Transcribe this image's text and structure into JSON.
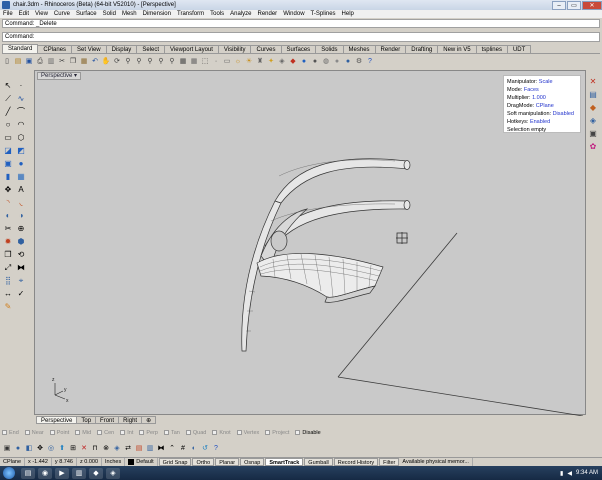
{
  "window": {
    "title": "chair.3dm - Rhinoceros (Beta) (64-bit V52010) - [Perspective]",
    "minimize": "–",
    "maximize": "▭",
    "close": "✕"
  },
  "menu": [
    "File",
    "Edit",
    "View",
    "Curve",
    "Surface",
    "Solid",
    "Mesh",
    "Dimension",
    "Transform",
    "Tools",
    "Analyze",
    "Render",
    "Window",
    "T-Splines",
    "Help"
  ],
  "command": {
    "history": "Command: _Delete",
    "prompt_label": "Command:",
    "value": ""
  },
  "tabs": [
    "Standard",
    "CPlanes",
    "Set View",
    "Display",
    "Select",
    "Viewport Layout",
    "Visibility",
    "Curves",
    "Surfaces",
    "Solids",
    "Meshes",
    "Render",
    "Drafting",
    "New in V5",
    "tsplines",
    "UDT"
  ],
  "active_tab": "Standard",
  "toolbar_icons": [
    {
      "name": "new-icon",
      "glyph": "▯",
      "color": "#444"
    },
    {
      "name": "open-icon",
      "glyph": "▤",
      "color": "#b08020"
    },
    {
      "name": "save-icon",
      "glyph": "▣",
      "color": "#2050a0"
    },
    {
      "name": "print-icon",
      "glyph": "⎙",
      "color": "#444"
    },
    {
      "name": "import-icon",
      "glyph": "▥",
      "color": "#666"
    },
    {
      "name": "cut-icon",
      "glyph": "✂",
      "color": "#444"
    },
    {
      "name": "copy-icon",
      "glyph": "❐",
      "color": "#444"
    },
    {
      "name": "paste-icon",
      "glyph": "▦",
      "color": "#8a6a30"
    },
    {
      "name": "undo-icon",
      "glyph": "↶",
      "color": "#2050a0"
    },
    {
      "name": "pan-icon",
      "glyph": "✋",
      "color": "#444"
    },
    {
      "name": "rotate-view-icon",
      "glyph": "⟳",
      "color": "#444"
    },
    {
      "name": "zoom-icon",
      "glyph": "⚲",
      "color": "#444"
    },
    {
      "name": "zoom-window-icon",
      "glyph": "⚲",
      "color": "#444"
    },
    {
      "name": "zoom-extents-icon",
      "glyph": "⚲",
      "color": "#444"
    },
    {
      "name": "zoom-selected-icon",
      "glyph": "⚲",
      "color": "#444"
    },
    {
      "name": "zoom-all-icon",
      "glyph": "⚲",
      "color": "#444"
    },
    {
      "name": "four-view-icon",
      "glyph": "▦",
      "color": "#444"
    },
    {
      "name": "grid-icon",
      "glyph": "▦",
      "color": "#666"
    },
    {
      "name": "cplane-icon",
      "glyph": "⬚",
      "color": "#444"
    },
    {
      "name": "point-icon",
      "glyph": "·",
      "color": "#444"
    },
    {
      "name": "select-icon",
      "glyph": "▭",
      "color": "#666"
    },
    {
      "name": "show-icon",
      "glyph": "☼",
      "color": "#c89020"
    },
    {
      "name": "hide-icon",
      "glyph": "☀",
      "color": "#c89020"
    },
    {
      "name": "lock-icon",
      "glyph": "♜",
      "color": "#666"
    },
    {
      "name": "lightbulb-icon",
      "glyph": "✦",
      "color": "#d0a020"
    },
    {
      "name": "properties-icon",
      "glyph": "◈",
      "color": "#666"
    },
    {
      "name": "layers-icon",
      "glyph": "◆",
      "color": "#c03020"
    },
    {
      "name": "render-icon",
      "glyph": "●",
      "color": "#2060c0"
    },
    {
      "name": "shade-icon",
      "glyph": "●",
      "color": "#555"
    },
    {
      "name": "wire-sphere-icon",
      "glyph": "◍",
      "color": "#666"
    },
    {
      "name": "rendered-sphere-icon",
      "glyph": "●",
      "color": "#8a8a8a"
    },
    {
      "name": "material-sphere-icon",
      "glyph": "●",
      "color": "#3060a0"
    },
    {
      "name": "options-icon",
      "glyph": "⚙",
      "color": "#555"
    },
    {
      "name": "help-icon",
      "glyph": "?",
      "color": "#2050c0"
    }
  ],
  "left_tools": [
    {
      "name": "select-arrow-icon",
      "glyph": "↖",
      "color": "#000"
    },
    {
      "name": "point-tool-icon",
      "glyph": "·",
      "color": "#000"
    },
    {
      "name": "polyline-icon",
      "glyph": "⟋",
      "color": "#000"
    },
    {
      "name": "curve-cv-icon",
      "glyph": "∿",
      "color": "#2050a0"
    },
    {
      "name": "line-icon",
      "glyph": "╱",
      "color": "#000"
    },
    {
      "name": "curve-icon",
      "glyph": "⌒",
      "color": "#000"
    },
    {
      "name": "circle-icon",
      "glyph": "○",
      "color": "#000"
    },
    {
      "name": "arc-icon",
      "glyph": "◠",
      "color": "#000"
    },
    {
      "name": "rectangle-icon",
      "glyph": "▭",
      "color": "#000"
    },
    {
      "name": "polygon-icon",
      "glyph": "⬡",
      "color": "#000"
    },
    {
      "name": "surface-icon",
      "glyph": "◪",
      "color": "#2060c0"
    },
    {
      "name": "extrude-icon",
      "glyph": "◩",
      "color": "#2060c0"
    },
    {
      "name": "box-icon",
      "glyph": "▣",
      "color": "#2060c0"
    },
    {
      "name": "sphere-icon",
      "glyph": "●",
      "color": "#2060c0"
    },
    {
      "name": "cylinder-icon",
      "glyph": "▮",
      "color": "#2060c0"
    },
    {
      "name": "mesh-icon",
      "glyph": "▦",
      "color": "#3070c0"
    },
    {
      "name": "move-icon",
      "glyph": "✥",
      "color": "#000"
    },
    {
      "name": "text-icon",
      "glyph": "A",
      "color": "#000"
    },
    {
      "name": "fillet-icon",
      "glyph": "◝",
      "color": "#c05020"
    },
    {
      "name": "blend-icon",
      "glyph": "◟",
      "color": "#c05020"
    },
    {
      "name": "boolean-icon",
      "glyph": "◐",
      "color": "#3060a0"
    },
    {
      "name": "split-icon",
      "glyph": "◑",
      "color": "#3060a0"
    },
    {
      "name": "trim-icon",
      "glyph": "✂",
      "color": "#000"
    },
    {
      "name": "join-icon",
      "glyph": "⊕",
      "color": "#000"
    },
    {
      "name": "explode-icon",
      "glyph": "✹",
      "color": "#c04020"
    },
    {
      "name": "group-icon",
      "glyph": "⬢",
      "color": "#3060a0"
    },
    {
      "name": "copy-tool-icon",
      "glyph": "❐",
      "color": "#000"
    },
    {
      "name": "rotate-icon",
      "glyph": "⟲",
      "color": "#000"
    },
    {
      "name": "scale-icon",
      "glyph": "⤢",
      "color": "#000"
    },
    {
      "name": "mirror-icon",
      "glyph": "⧓",
      "color": "#000"
    },
    {
      "name": "array-icon",
      "glyph": "⣿",
      "color": "#3060a0"
    },
    {
      "name": "analyze-icon",
      "glyph": "⌖",
      "color": "#3060a0"
    },
    {
      "name": "dimension-icon",
      "glyph": "↔",
      "color": "#000"
    },
    {
      "name": "check-icon",
      "glyph": "✓",
      "color": "#000"
    },
    {
      "name": "paint-icon",
      "glyph": "✎",
      "color": "#d08020"
    }
  ],
  "right_tools": [
    {
      "name": "close-panel-icon",
      "glyph": "✕",
      "color": "#c03020"
    },
    {
      "name": "properties-panel-icon",
      "glyph": "▤",
      "color": "#3060a0"
    },
    {
      "name": "layers-panel-icon",
      "glyph": "◆",
      "color": "#c06020"
    },
    {
      "name": "display-panel-icon",
      "glyph": "◈",
      "color": "#3060a0"
    },
    {
      "name": "help-panel-icon",
      "glyph": "▣",
      "color": "#444"
    },
    {
      "name": "tspline-panel-icon",
      "glyph": "✿",
      "color": "#c02080"
    }
  ],
  "viewport": {
    "label": "Perspective",
    "info": [
      {
        "key": "Manipulator: ",
        "value": "Scale"
      },
      {
        "key": "Mode: ",
        "value": "Faces"
      },
      {
        "key": "Multiplier: ",
        "value": "1.000"
      },
      {
        "key": "DragMode: ",
        "value": "CPlane"
      },
      {
        "key": "Soft manipulation: ",
        "value": "Disabled"
      },
      {
        "key": "Hotkeys: ",
        "value": "Enabled"
      },
      {
        "key": "Selection empty",
        "value": ""
      }
    ],
    "axis_x": "x",
    "axis_y": "y",
    "axis_z": "z"
  },
  "view_tabs": [
    "Perspective",
    "Top",
    "Front",
    "Right"
  ],
  "view_tab_add": "⊕",
  "osnaps": [
    {
      "label": "End",
      "enabled": false
    },
    {
      "label": "Near",
      "enabled": false
    },
    {
      "label": "Point",
      "enabled": false
    },
    {
      "label": "Mid",
      "enabled": false
    },
    {
      "label": "Cen",
      "enabled": false
    },
    {
      "label": "Int",
      "enabled": false
    },
    {
      "label": "Perp",
      "enabled": false
    },
    {
      "label": "Tan",
      "enabled": false
    },
    {
      "label": "Quad",
      "enabled": false
    },
    {
      "label": "Knot",
      "enabled": false
    },
    {
      "label": "Vertex",
      "enabled": false
    },
    {
      "label": "Project",
      "enabled": false
    },
    {
      "label": "Disable",
      "enabled": true
    }
  ],
  "bottom_tools": [
    {
      "name": "tspline-box-icon",
      "glyph": "▣",
      "color": "#333"
    },
    {
      "name": "tspline-sphere-icon",
      "glyph": "●",
      "color": "#3060a0"
    },
    {
      "name": "tspline-plane-icon",
      "glyph": "◧",
      "color": "#3060a0"
    },
    {
      "name": "tspline-move-icon",
      "glyph": "✥",
      "color": "#000"
    },
    {
      "name": "tspline-smooth-icon",
      "glyph": "◎",
      "color": "#3060a0"
    },
    {
      "name": "tspline-extrude-icon",
      "glyph": "⬆",
      "color": "#2080c0"
    },
    {
      "name": "tspline-insert-icon",
      "glyph": "⊞",
      "color": "#000"
    },
    {
      "name": "tspline-delete-icon",
      "glyph": "✕",
      "color": "#c02020"
    },
    {
      "name": "tspline-bridge-icon",
      "glyph": "⊓",
      "color": "#000"
    },
    {
      "name": "tspline-weld-icon",
      "glyph": "⊗",
      "color": "#000"
    },
    {
      "name": "tspline-mode-icon",
      "glyph": "◈",
      "color": "#3060a0"
    },
    {
      "name": "tspline-convert-icon",
      "glyph": "⇄",
      "color": "#000"
    },
    {
      "name": "tspline-nurbs-icon",
      "glyph": "▤",
      "color": "#c04020"
    },
    {
      "name": "tspline-thicken-icon",
      "glyph": "▥",
      "color": "#3060a0"
    },
    {
      "name": "tspline-symmetry-icon",
      "glyph": "⧓",
      "color": "#000"
    },
    {
      "name": "tspline-crease-icon",
      "glyph": "⌃",
      "color": "#000"
    },
    {
      "name": "tspline-grid-icon",
      "glyph": "#",
      "color": "#000"
    },
    {
      "name": "tspline-display-icon",
      "glyph": "◐",
      "color": "#3060a0"
    },
    {
      "name": "tspline-match-icon",
      "glyph": "↺",
      "color": "#2080c0"
    },
    {
      "name": "tspline-help-icon",
      "glyph": "?",
      "color": "#2050c0"
    }
  ],
  "status": {
    "cplane": "CPlane",
    "x": "x -1.442",
    "y": "y 8.746",
    "z": "z 0.000",
    "units": "Inches",
    "layer": "Default",
    "buttons": [
      {
        "label": "Grid Snap",
        "on": false
      },
      {
        "label": "Ortho",
        "on": false
      },
      {
        "label": "Planar",
        "on": false
      },
      {
        "label": "Osnap",
        "on": false
      },
      {
        "label": "SmartTrack",
        "on": true
      },
      {
        "label": "Gumball",
        "on": false
      },
      {
        "label": "Record History",
        "on": false
      },
      {
        "label": "Filter",
        "on": false
      }
    ],
    "message": "Available physical memor..."
  },
  "taskbar": {
    "apps": [
      {
        "name": "explorer-task-icon",
        "glyph": "▤"
      },
      {
        "name": "browser-task-icon",
        "glyph": "◉"
      },
      {
        "name": "media-task-icon",
        "glyph": "▶"
      },
      {
        "name": "folder-task-icon",
        "glyph": "▥"
      },
      {
        "name": "rhino-task-icon",
        "glyph": "◆"
      },
      {
        "name": "app-task-icon",
        "glyph": "◈"
      }
    ],
    "clock": "9:34 AM"
  }
}
